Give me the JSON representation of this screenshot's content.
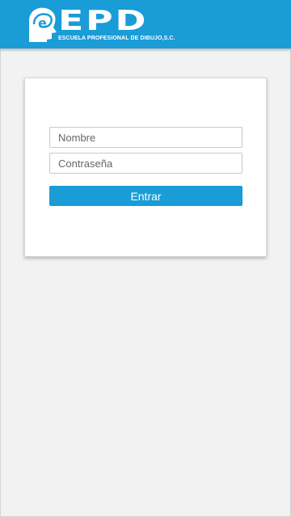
{
  "header": {
    "brand": "EPD",
    "tagline": "ESCUELA PROFESIONAL DE DIBUJO,S.C.",
    "logo_icon": "head-profile-logo-icon"
  },
  "login": {
    "username_placeholder": "Nombre",
    "password_placeholder": "Contraseña",
    "submit_label": "Entrar"
  },
  "colors": {
    "brand_blue": "#1a9cd6",
    "background": "#f2f2f2",
    "card": "#ffffff"
  }
}
